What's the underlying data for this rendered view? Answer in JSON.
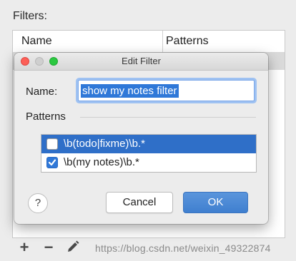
{
  "background": {
    "filters_label": "Filters:",
    "table_columns": [
      "Name",
      "Patterns"
    ]
  },
  "toolbar": {
    "add_icon": "plus-icon",
    "remove_icon": "minus-icon",
    "edit_icon": "pencil-icon"
  },
  "watermark": "https://blog.csdn.net/weixin_49322874",
  "dialog": {
    "title": "Edit Filter",
    "name_label": "Name:",
    "name_value": "show my notes filter",
    "patterns_label": "Patterns",
    "patterns": [
      {
        "text": "\\b(todo|fixme)\\b.*",
        "checked": false,
        "selected": true
      },
      {
        "text": "\\b(my notes)\\b.*",
        "checked": true,
        "selected": false
      }
    ],
    "help_label": "?",
    "cancel_label": "Cancel",
    "ok_label": "OK"
  },
  "colors": {
    "accent": "#2f78d8",
    "selection_row": "#2f6fc8",
    "traffic_close": "#fc5f57",
    "traffic_max": "#2bc840"
  }
}
